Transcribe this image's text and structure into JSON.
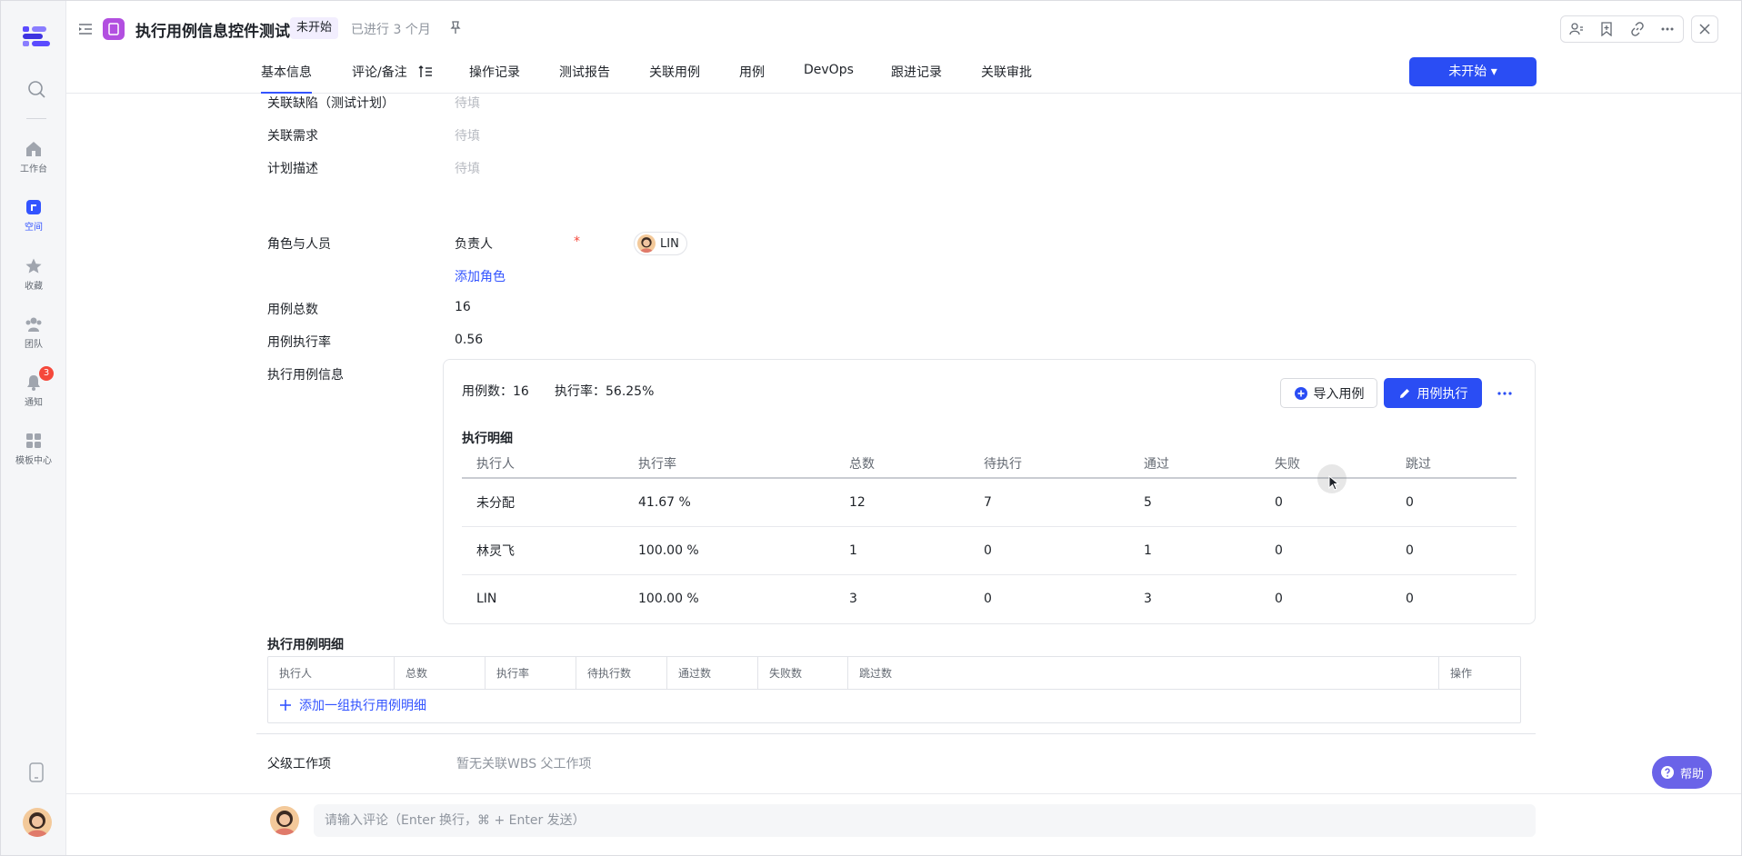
{
  "header": {
    "title": "执行用例信息控件测试",
    "status_tag": "未开始",
    "elapsed": "已进行 3 个月"
  },
  "rail": {
    "items": [
      {
        "label": "工作台",
        "icon": "home-icon"
      },
      {
        "label": "空间",
        "icon": "space-icon"
      },
      {
        "label": "收藏",
        "icon": "star-icon"
      },
      {
        "label": "团队",
        "icon": "team-icon"
      },
      {
        "label": "通知",
        "icon": "bell-icon"
      },
      {
        "label": "模板中心",
        "icon": "template-icon"
      }
    ],
    "notification_badge": "3"
  },
  "tabs": [
    {
      "label": "基本信息"
    },
    {
      "label": "评论/备注"
    },
    {
      "label": "操作记录"
    },
    {
      "label": "测试报告"
    },
    {
      "label": "关联用例"
    },
    {
      "label": "用例"
    },
    {
      "label": "DevOps"
    },
    {
      "label": "跟进记录"
    },
    {
      "label": "关联审批"
    }
  ],
  "status_button": "未开始 ▾",
  "fields": {
    "related_defects": {
      "label": "关联缺陷（测试计划）",
      "value": "待填"
    },
    "related_requirements": {
      "label": "关联需求",
      "value": "待填"
    },
    "plan_description": {
      "label": "计划描述",
      "value": "待填"
    },
    "roles": {
      "label": "角色与人员",
      "role": "负责人",
      "required_mark": "*",
      "user": "LIN",
      "add_role": "添加角色"
    },
    "case_total": {
      "label": "用例总数",
      "value": "16"
    },
    "case_exec_rate": {
      "label": "用例执行率",
      "value": "0.56"
    },
    "exec_info": {
      "label": "执行用例信息"
    }
  },
  "exec_card": {
    "case_count_label": "用例数：",
    "case_count": "16",
    "exec_rate_label": "执行率：",
    "exec_rate": "56.25%",
    "import_button": "导入用例",
    "exec_button": "用例执行",
    "subtitle": "执行明细",
    "columns": [
      "执行人",
      "执行率",
      "总数",
      "待执行",
      "通过",
      "失败",
      "跳过"
    ],
    "rows": [
      [
        "未分配",
        "41.67 %",
        "12",
        "7",
        "5",
        "0",
        "0"
      ],
      [
        "林灵飞",
        "100.00 %",
        "1",
        "0",
        "1",
        "0",
        "0"
      ],
      [
        "LIN",
        "100.00 %",
        "3",
        "0",
        "3",
        "0",
        "0"
      ]
    ]
  },
  "detail": {
    "title": "执行用例明细",
    "columns": [
      "执行人",
      "总数",
      "执行率",
      "待执行数",
      "通过数",
      "失败数",
      "跳过数",
      "操作"
    ],
    "add_label": "添加一组执行用例明细"
  },
  "parent": {
    "label": "父级工作项",
    "value": "暂无关联WBS 父工作项"
  },
  "comment": {
    "placeholder": "请输入评论（Enter 换行，⌘ + Enter 发送）"
  },
  "help": "帮助",
  "colors": {
    "accent": "#2a4df4",
    "type_icon": "#b24fe0",
    "help": "#6a63e8",
    "badge": "#f5483b"
  }
}
